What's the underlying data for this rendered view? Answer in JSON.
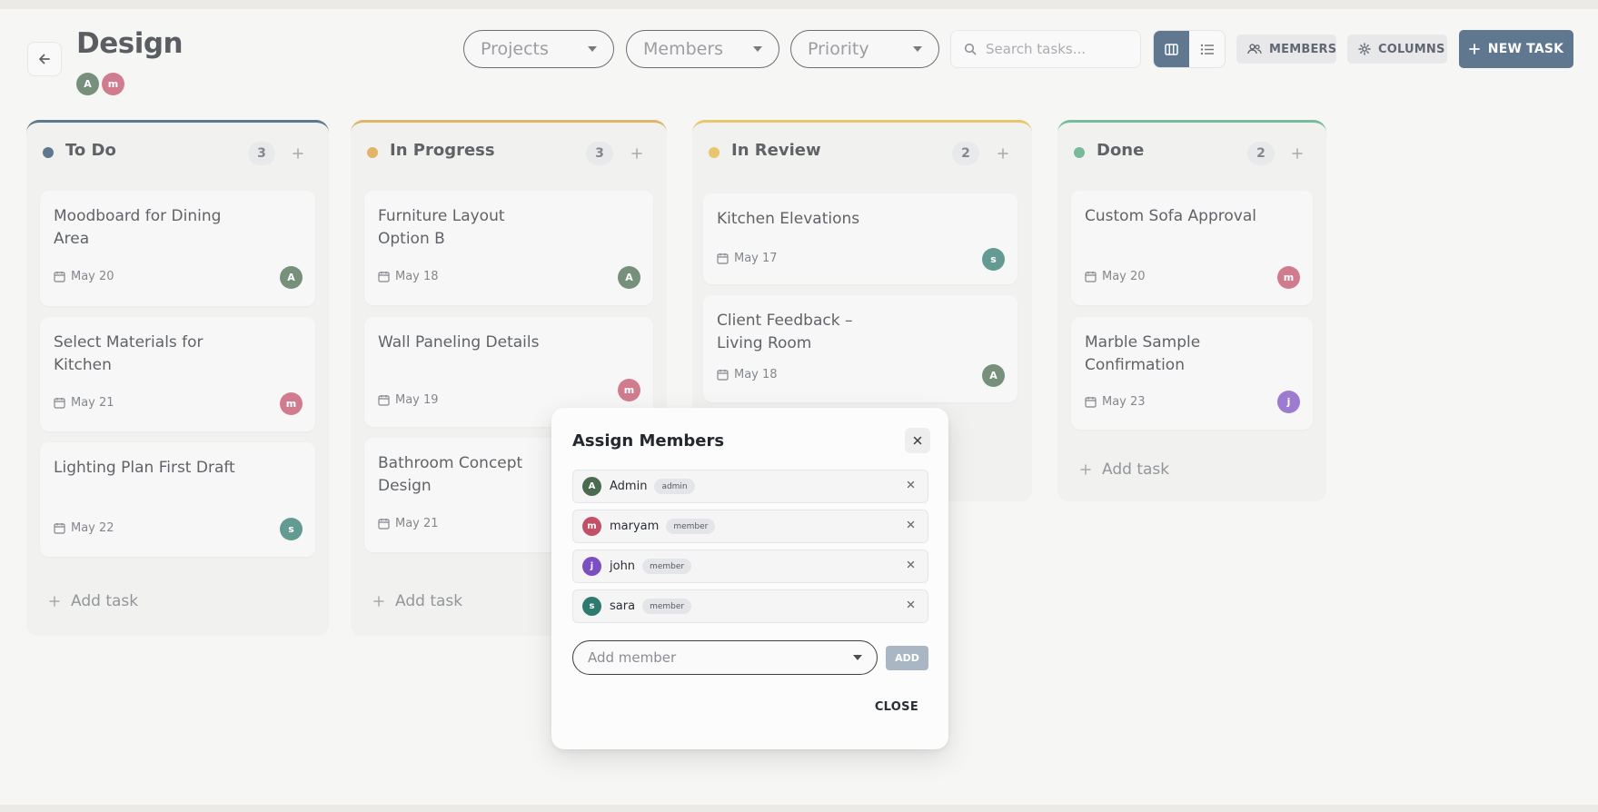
{
  "header": {
    "title": "Design",
    "members": [
      {
        "initial": "A",
        "color": "#4a6b4f"
      },
      {
        "initial": "m",
        "color": "#c25068"
      }
    ]
  },
  "toolbar": {
    "filters": [
      {
        "label": "Projects"
      },
      {
        "label": "Members"
      },
      {
        "label": "Priority"
      }
    ],
    "search_placeholder": "Search tasks...",
    "members_label": "MEMBERS",
    "columns_label": "COLUMNS",
    "new_task_label": "NEW TASK"
  },
  "columns": [
    {
      "title": "To Do",
      "count": "3",
      "color": "#2b4a6b",
      "add_task_label": "Add task",
      "cards": [
        {
          "title": "Moodboard for Dining Area",
          "date": "May 20",
          "assignee": "A",
          "assignee_color": "#4a6b4f"
        },
        {
          "title": "Select Materials for Kitchen",
          "date": "May 21",
          "assignee": "m",
          "assignee_color": "#c25068"
        },
        {
          "title": "Lighting Plan First Draft",
          "date": "May 22",
          "assignee": "s",
          "assignee_color": "#2f7a6f"
        }
      ]
    },
    {
      "title": "In Progress",
      "count": "3",
      "color": "#d99a3a",
      "add_task_label": "Add task",
      "cards": [
        {
          "title": "Furniture Layout Option B",
          "date": "May 18",
          "assignee": "A",
          "assignee_color": "#4a6b4f"
        },
        {
          "title": "Wall Paneling Details",
          "date": "May 19",
          "assignee": "m",
          "assignee_color": "#c25068"
        },
        {
          "title": "Bathroom Concept Design",
          "date": "May 21",
          "assignee": "",
          "assignee_color": ""
        }
      ]
    },
    {
      "title": "In Review",
      "count": "2",
      "color": "#e2b33c",
      "add_task_label": "",
      "cards": [
        {
          "title": "Kitchen Elevations",
          "date": "May 17",
          "assignee": "s",
          "assignee_color": "#2f7a6f"
        },
        {
          "title": "Client Feedback – Living Room",
          "date": "May 18",
          "assignee": "A",
          "assignee_color": "#4a6b4f"
        }
      ]
    },
    {
      "title": "Done",
      "count": "2",
      "color": "#4aa57a",
      "add_task_label": "Add task",
      "cards": [
        {
          "title": "Custom Sofa Approval",
          "date": "May 20",
          "assignee": "m",
          "assignee_color": "#c25068"
        },
        {
          "title": "Marble Sample Confirmation",
          "date": "May 23",
          "assignee": "j",
          "assignee_color": "#7b4fc2"
        }
      ]
    }
  ],
  "modal": {
    "title": "Assign Members",
    "members": [
      {
        "initial": "A",
        "name": "Admin",
        "role": "admin",
        "color": "#4a6b4f"
      },
      {
        "initial": "m",
        "name": "maryam",
        "role": "member",
        "color": "#c25068"
      },
      {
        "initial": "j",
        "name": "john",
        "role": "member",
        "color": "#7b4fc2"
      },
      {
        "initial": "s",
        "name": "sara",
        "role": "member",
        "color": "#2f7a6f"
      }
    ],
    "add_member_placeholder": "Add member",
    "add_label": "ADD",
    "close_label": "CLOSE"
  }
}
